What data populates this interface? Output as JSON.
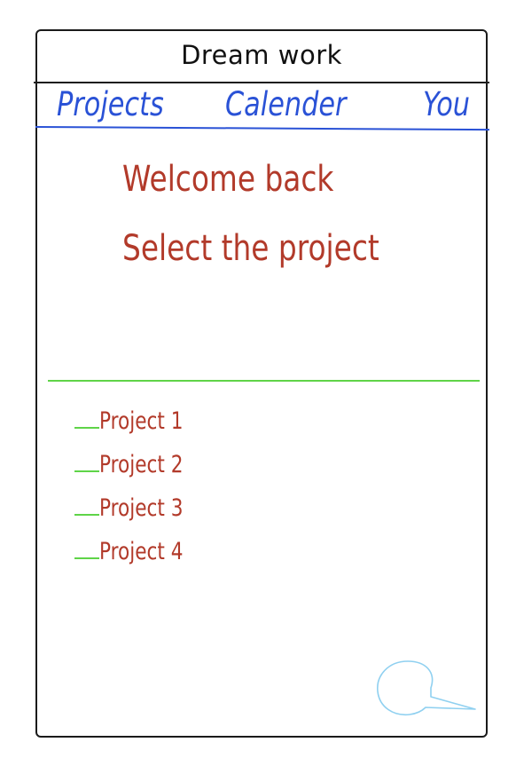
{
  "header": {
    "title": "Dream work"
  },
  "nav": {
    "projects_label": "Projects",
    "calender_label": "Calender",
    "you_label": "You"
  },
  "main": {
    "welcome": "Welcome back",
    "prompt": "Select the project",
    "projects": [
      {
        "label": "Project 1"
      },
      {
        "label": "Project 2"
      },
      {
        "label": "Project 3"
      },
      {
        "label": "Project 4"
      }
    ]
  },
  "icons": {
    "chat": "chat-bubble-icon"
  },
  "colors": {
    "title_text": "#111111",
    "nav_blue": "#2a52d6",
    "accent_red": "#b23a2a",
    "divider_green": "#5fd448",
    "chat_icon": "#8fd0f0"
  }
}
